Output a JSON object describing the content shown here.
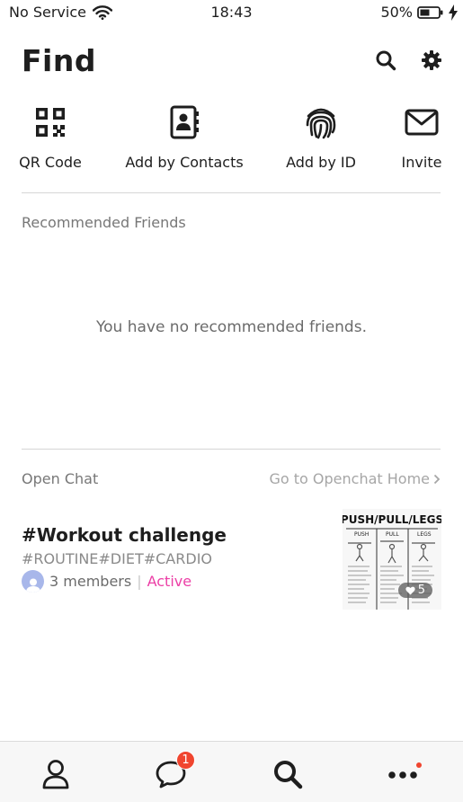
{
  "status": {
    "carrier": "No Service",
    "time": "18:43",
    "battery": "50%",
    "icons": [
      "wifi-icon",
      "battery-icon",
      "charging-bolt-icon"
    ]
  },
  "header": {
    "title": "Find",
    "icons": [
      "search-icon",
      "gear-icon"
    ]
  },
  "actions": [
    {
      "label": "QR Code",
      "icon": "qr-code-icon"
    },
    {
      "label": "Add by Contacts",
      "icon": "contacts-book-icon"
    },
    {
      "label": "Add by ID",
      "icon": "fingerprint-icon"
    },
    {
      "label": "Invite",
      "icon": "envelope-icon"
    }
  ],
  "recommended": {
    "label": "Recommended Friends",
    "empty_message": "You have no recommended friends."
  },
  "openchat": {
    "label": "Open Chat",
    "home_link": "Go to Openchat Home",
    "card": {
      "title": "#Workout challenge",
      "tags": "#ROUTINE#DIET#CARDIO",
      "members": "3 members",
      "status": "Active",
      "thumbnail": {
        "heading": "PUSH/PULL/LEGS",
        "columns": [
          "PUSH",
          "PULL",
          "LEGS"
        ],
        "like_count": "5"
      }
    }
  },
  "tabbar": {
    "tabs": [
      {
        "name": "friends",
        "icon": "person-icon"
      },
      {
        "name": "chats",
        "icon": "chat-bubble-icon",
        "badge": "1"
      },
      {
        "name": "find",
        "icon": "search-icon",
        "active": true
      },
      {
        "name": "more",
        "icon": "more-dots-icon",
        "dot": true
      }
    ]
  },
  "colors": {
    "accent_pink": "#ec3fa6",
    "badge_red": "#f0452f",
    "text_dark": "#1e1e1e",
    "text_gray": "#777777"
  }
}
